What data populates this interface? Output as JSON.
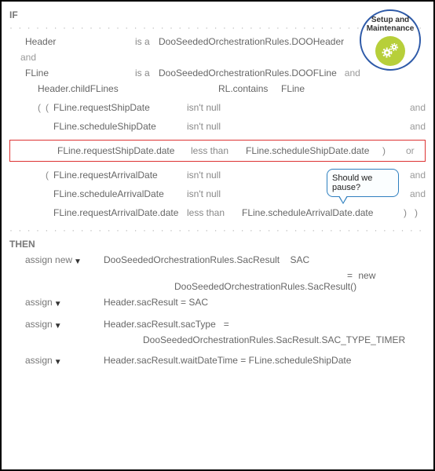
{
  "badge": {
    "line1": "Setup and",
    "line2": "Maintenance"
  },
  "callout": {
    "text": "Should we pause?"
  },
  "if": {
    "label": "IF",
    "r1": {
      "lhs": "Header",
      "kw": "is a",
      "rhs": "DooSeededOrchestrationRules.DOOHeader"
    },
    "and1": "and",
    "r2": {
      "lhs": "FLine",
      "kw": "is a",
      "rhs": "DooSeededOrchestrationRules.DOOFLine",
      "trail": "and"
    },
    "r3": {
      "lhs": "Header.childFLines",
      "op": "RL.contains",
      "rhs": "FLine"
    },
    "c1": {
      "p1": "(",
      "p2": "(",
      "lhs": "FLine.requestShipDate",
      "op": "isn't",
      "opv": "null",
      "conn": "and"
    },
    "c2": {
      "lhs": "FLine.scheduleShipDate",
      "op": "isn't",
      "opv": "null",
      "conn": "and"
    },
    "c3": {
      "lhs": "FLine.requestShipDate.date",
      "op": "less than",
      "rhs": "FLine.scheduleShipDate.date",
      "pclose": ")",
      "conn": "or"
    },
    "c4": {
      "p2": "(",
      "lhs": "FLine.requestArrivalDate",
      "op": "isn't",
      "opv": "null",
      "conn": "and"
    },
    "c5": {
      "lhs": "FLine.scheduleArrivalDate",
      "op": "isn't",
      "opv": "null",
      "conn": "and"
    },
    "c6": {
      "lhs": "FLine.requestArrivalDate.date",
      "op": "less than",
      "rhs": "FLine.scheduleArrivalDate.date",
      "pclose": ")",
      "pclose2": ")"
    }
  },
  "then": {
    "label": "THEN",
    "a1": {
      "kw": "assign new",
      "lhs": "DooSeededOrchestrationRules.SacResult",
      "var": "SAC",
      "eq": "=",
      "sub": "new DooSeededOrchestrationRules.SacResult()"
    },
    "a2": {
      "kw": "assign",
      "expr": "Header.sacResult   =  SAC"
    },
    "a3": {
      "kw": "assign",
      "lhs": "Header.sacResult.sacType",
      "eq": "=",
      "rhs": "DooSeededOrchestrationRules.SacResult.SAC_TYPE_TIMER"
    },
    "a4": {
      "kw": "assign",
      "expr": "Header.sacResult.waitDateTime  =   FLine.scheduleShipDate"
    }
  }
}
